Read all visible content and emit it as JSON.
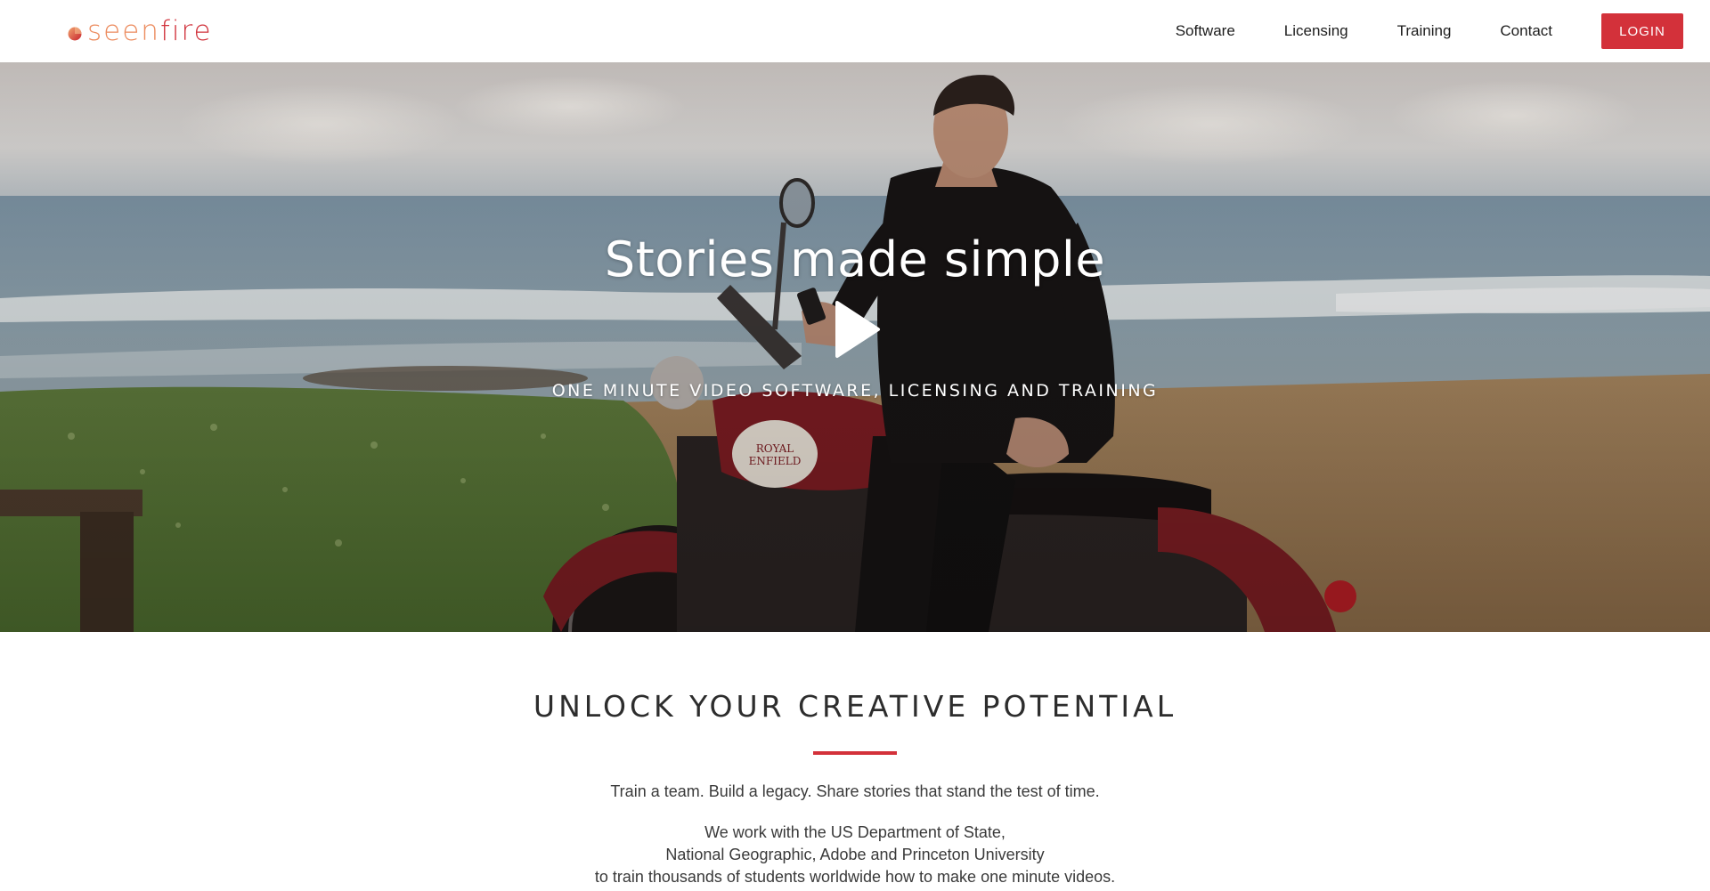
{
  "brand": {
    "logo_part1": "seen",
    "logo_part2": "fire",
    "accent_color": "#d3313a",
    "logo_orange": "#ec8c5f"
  },
  "nav": {
    "items": [
      {
        "label": "Software"
      },
      {
        "label": "Licensing"
      },
      {
        "label": "Training"
      },
      {
        "label": "Contact"
      }
    ],
    "login_label": "LOGIN"
  },
  "hero": {
    "title": "Stories made simple",
    "subtitle": "ONE MINUTE VIDEO SOFTWARE, LICENSING AND TRAINING",
    "play_icon": "play-icon",
    "motorcycle_tank_text": "ROYAL ENFIELD"
  },
  "section": {
    "heading": "UNLOCK YOUR CREATIVE POTENTIAL",
    "paragraph1": "Train a team. Build a legacy. Share stories that stand the test of time.",
    "paragraph2_lines": [
      "We work with the US Department of State,",
      "National Geographic, Adobe and Princeton University",
      "to train thousands of students worldwide how to make one minute videos."
    ]
  }
}
